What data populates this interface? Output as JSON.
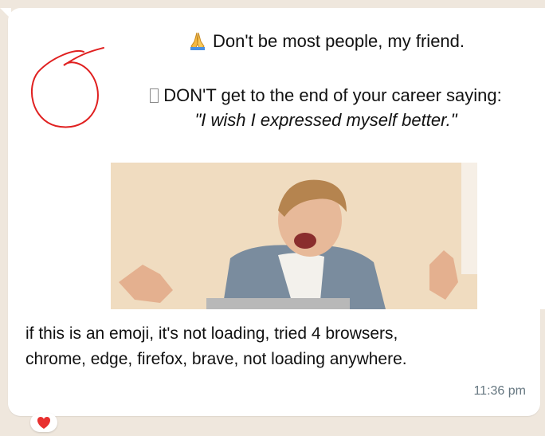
{
  "message": {
    "headline": "Don't be most people, my friend.",
    "headline_icon": "folded-hands-emoji",
    "subline": "DON'T get to the end of your career saying:",
    "quote": "\"I wish I expressed myself better.\"",
    "body": "if this is an emoji, it's not loading, tried 4 browsers, chrome, edge, firefox, brave, not loading anywhere.",
    "timestamp": "11:36 pm",
    "reaction_icon": "red-heart-emoji"
  },
  "colors": {
    "background": "#efe7dd",
    "bubble": "#ffffff",
    "annotation": "#e02020",
    "timestamp": "#667781"
  }
}
